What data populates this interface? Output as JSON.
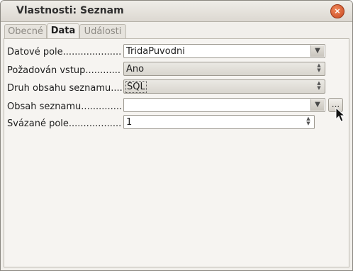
{
  "window": {
    "title": "Vlastnosti: Seznam",
    "close_label": "×"
  },
  "tabs": [
    {
      "label": "Obecné",
      "active": false
    },
    {
      "label": "Data",
      "active": true
    },
    {
      "label": "Události",
      "active": false
    }
  ],
  "fields": {
    "data_field": {
      "label": "Datové pole....................",
      "value": "TridaPuvodni"
    },
    "input_required": {
      "label": "Požadován vstup............",
      "value": "Ano"
    },
    "list_content_type": {
      "label": "Druh obsahu seznamu....",
      "value": "SQL"
    },
    "list_content": {
      "label": "Obsah seznamu..............",
      "value": "",
      "button_label": "..."
    },
    "bound_field": {
      "label": "Svázané pole..................",
      "value": "1"
    }
  },
  "icons": {
    "dropdown": "chevron-down-icon",
    "spin": "spin-arrows-icon",
    "cursor": "mouse-pointer-icon"
  }
}
